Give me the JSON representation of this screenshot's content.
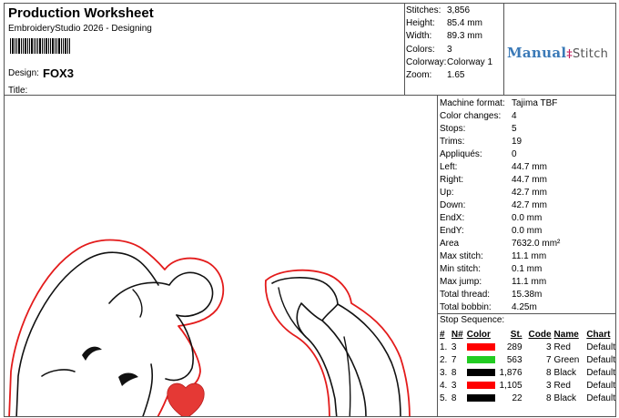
{
  "header": {
    "title": "Production Worksheet",
    "app": "EmbroideryStudio 2026 - Designing",
    "design_label": "Design:",
    "design_value": "FOX3",
    "title_label": "Title:"
  },
  "stats": [
    {
      "label": "Stitches:",
      "value": "3,856"
    },
    {
      "label": "Height:",
      "value": "85.4 mm"
    },
    {
      "label": "Width:",
      "value": "89.3 mm"
    },
    {
      "label": "Colors:",
      "value": "3"
    },
    {
      "label": "Colorway:",
      "value": "Colorway 1"
    },
    {
      "label": "Zoom:",
      "value": "1.65"
    }
  ],
  "logo": {
    "word1": "Manual",
    "word2": "Stitch",
    "icon": "thread-spool-icon",
    "color": "#3a79b7"
  },
  "properties": [
    {
      "label": "Machine format:",
      "value": "Tajima TBF"
    },
    {
      "label": "Color changes:",
      "value": "4"
    },
    {
      "label": "Stops:",
      "value": "5"
    },
    {
      "label": "Trims:",
      "value": "19"
    },
    {
      "label": "Appliqués:",
      "value": "0"
    },
    {
      "label": "Left:",
      "value": "44.7 mm"
    },
    {
      "label": "Right:",
      "value": "44.7 mm"
    },
    {
      "label": "Up:",
      "value": "42.7 mm"
    },
    {
      "label": "Down:",
      "value": "42.7 mm"
    },
    {
      "label": "EndX:",
      "value": "0.0 mm"
    },
    {
      "label": "EndY:",
      "value": "0.0 mm"
    },
    {
      "label": "Area",
      "value": "7632.0 mm²"
    },
    {
      "label": "Max stitch:",
      "value": "11.1 mm"
    },
    {
      "label": "Min stitch:",
      "value": "0.1 mm"
    },
    {
      "label": "Max jump:",
      "value": "11.1 mm"
    },
    {
      "label": "Total thread:",
      "value": "15.38m"
    },
    {
      "label": "Total bobbin:",
      "value": "4.25m"
    }
  ],
  "sequence": {
    "title": "Stop Sequence:",
    "headers": [
      "#",
      "N#",
      "Color",
      "St.",
      "Code",
      "Name",
      "Chart"
    ],
    "rows": [
      {
        "idx": "1.",
        "n": "3",
        "color": "#ff0000",
        "st": "289",
        "code": "3",
        "name": "Red",
        "chart": "Default"
      },
      {
        "idx": "2.",
        "n": "7",
        "color": "#22cc22",
        "st": "563",
        "code": "7",
        "name": "Green",
        "chart": "Default"
      },
      {
        "idx": "3.",
        "n": "8",
        "color": "#000000",
        "st": "1,876",
        "code": "8",
        "name": "Black",
        "chart": "Default"
      },
      {
        "idx": "4.",
        "n": "3",
        "color": "#ff0000",
        "st": "1,105",
        "code": "3",
        "name": "Red",
        "chart": "Default"
      },
      {
        "idx": "5.",
        "n": "8",
        "color": "#000000",
        "st": "22",
        "code": "8",
        "name": "Black",
        "chart": "Default"
      }
    ]
  },
  "design_colors": {
    "outline": "#e31b1b",
    "stitch": "#111111",
    "heart": "#e53935"
  }
}
